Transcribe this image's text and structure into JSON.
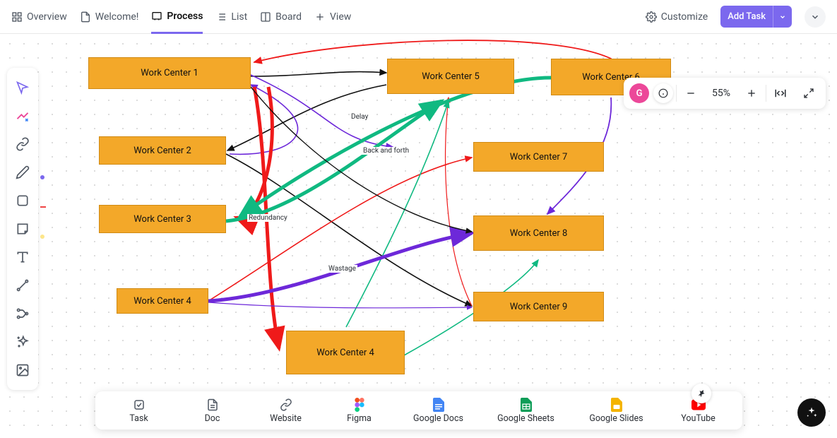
{
  "tabs": {
    "overview": "Overview",
    "welcome": "Welcome!",
    "process": "Process",
    "list": "List",
    "board": "Board",
    "addview": "View"
  },
  "actions": {
    "customize": "Customize",
    "addtask": "Add Task"
  },
  "avatar": "G",
  "zoom": "55%",
  "nodes": {
    "wc1": "Work Center 1",
    "wc2": "Work Center 2",
    "wc3": "Work Center 3",
    "wc4a": "Work Center 4",
    "wc4b": "Work Center 4",
    "wc5": "Work Center 5",
    "wc6": "Work Center 6",
    "wc7": "Work Center 7",
    "wc8": "Work Center 8",
    "wc9": "Work Center 9"
  },
  "edge_labels": {
    "delay": "Delay",
    "backforth": "Back and forth",
    "redundancy": "Redundancy",
    "wastage": "Wastage"
  },
  "bottombar": {
    "task": "Task",
    "doc": "Doc",
    "website": "Website",
    "figma": "Figma",
    "gdocs": "Google Docs",
    "gsheets": "Google Sheets",
    "gslides": "Google Slides",
    "youtube": "YouTube"
  },
  "colors": {
    "primary": "#7b68ee",
    "node": "#f3a829",
    "avatar": "#ec4899"
  },
  "chart_data": {
    "type": "diagram",
    "title": "Process",
    "nodes": [
      {
        "id": "wc1",
        "label": "Work Center 1"
      },
      {
        "id": "wc2",
        "label": "Work Center 2"
      },
      {
        "id": "wc3",
        "label": "Work Center 3"
      },
      {
        "id": "wc4a",
        "label": "Work Center 4"
      },
      {
        "id": "wc4b",
        "label": "Work Center 4"
      },
      {
        "id": "wc5",
        "label": "Work Center 5"
      },
      {
        "id": "wc6",
        "label": "Work Center 6"
      },
      {
        "id": "wc7",
        "label": "Work Center 7"
      },
      {
        "id": "wc8",
        "label": "Work Center 8"
      },
      {
        "id": "wc9",
        "label": "Work Center 9"
      }
    ],
    "edges": [
      {
        "from": "wc1",
        "to": "wc5",
        "color": "black"
      },
      {
        "from": "wc1",
        "to": "wc2",
        "color": "purple",
        "label": "Back and forth"
      },
      {
        "from": "wc1",
        "to": "wc4b",
        "color": "red"
      },
      {
        "from": "wc5",
        "to": "wc2",
        "color": "black",
        "label": "Delay"
      },
      {
        "from": "wc2",
        "to": "wc9",
        "color": "black"
      },
      {
        "from": "wc3",
        "to": "wc5",
        "color": "green",
        "label": "Redundancy"
      },
      {
        "from": "wc6",
        "to": "wc3",
        "color": "green"
      },
      {
        "from": "wc4a",
        "to": "wc7",
        "color": "red"
      },
      {
        "from": "wc4a",
        "to": "wc8",
        "color": "purple",
        "label": "Wastage"
      },
      {
        "from": "wc4a",
        "to": "wc9",
        "color": "purple"
      },
      {
        "from": "wc4b",
        "to": "wc5",
        "color": "green"
      },
      {
        "from": "wc4b",
        "to": "wc8",
        "color": "green"
      },
      {
        "from": "wc6",
        "to": "wc8",
        "color": "purple"
      },
      {
        "from": "wc6",
        "to": "wc1",
        "color": "red"
      },
      {
        "from": "wc9",
        "to": "wc5",
        "color": "red"
      }
    ]
  }
}
